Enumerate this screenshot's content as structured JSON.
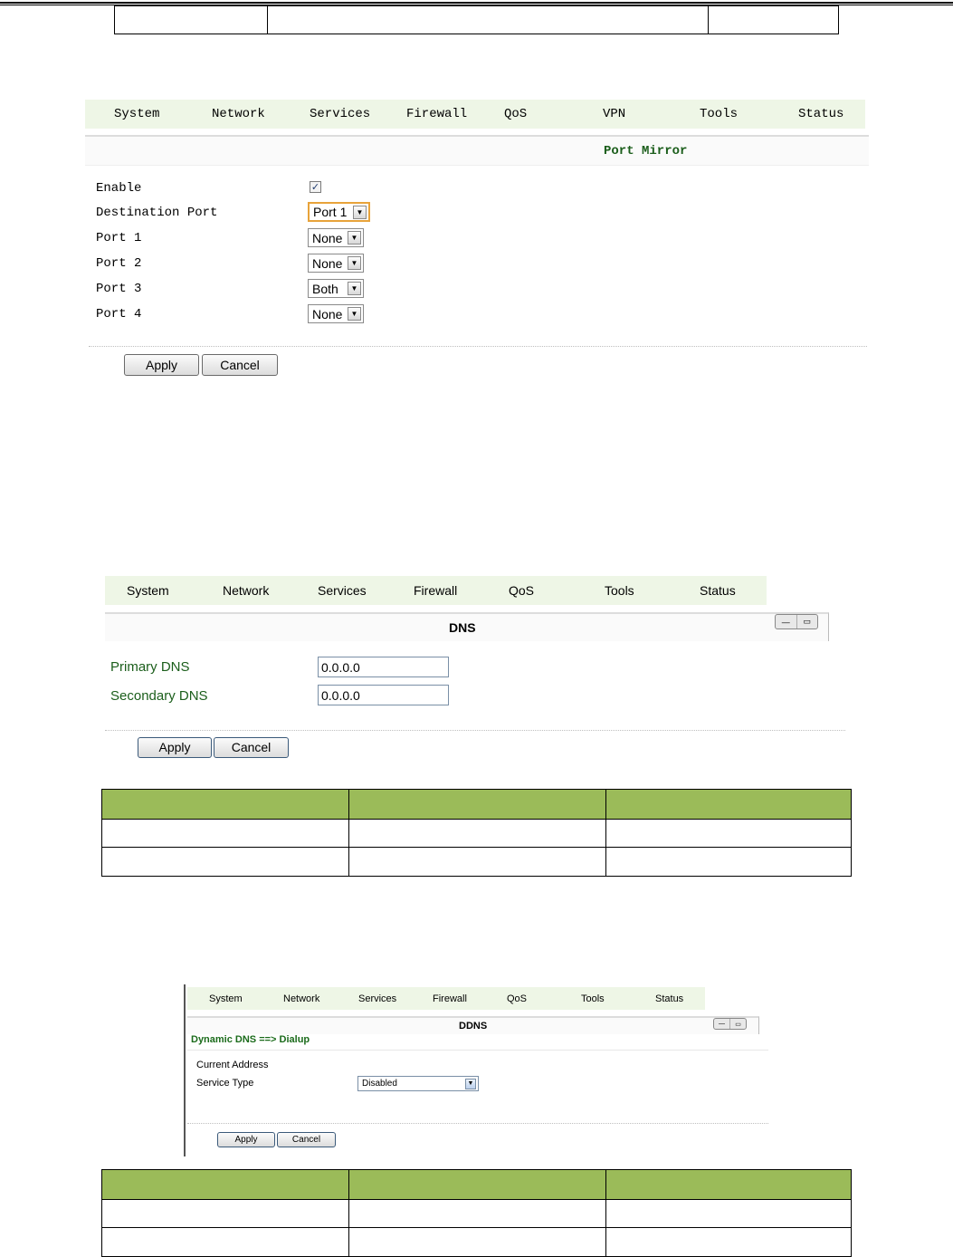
{
  "port_mirror": {
    "nav": [
      "System",
      "Network",
      "Services",
      "Firewall",
      "QoS",
      "VPN",
      "Tools",
      "Status"
    ],
    "title": "Port Mirror",
    "fields": [
      {
        "label": "Enable",
        "type": "checkbox",
        "checked": true
      },
      {
        "label": "Destination Port",
        "type": "select",
        "value": "Port 1"
      },
      {
        "label": "Port 1",
        "type": "select",
        "value": "None"
      },
      {
        "label": "Port 2",
        "type": "select",
        "value": "None"
      },
      {
        "label": "Port 3",
        "type": "select",
        "value": "Both"
      },
      {
        "label": "Port 4",
        "type": "select",
        "value": "None"
      }
    ],
    "apply_label": "Apply",
    "cancel_label": "Cancel"
  },
  "dns": {
    "nav": [
      "System",
      "Network",
      "Services",
      "Firewall",
      "QoS",
      "Tools",
      "Status"
    ],
    "title": "DNS",
    "primary_label": "Primary DNS",
    "primary_value": "0.0.0.0",
    "secondary_label": "Secondary DNS",
    "secondary_value": "0.0.0.0",
    "apply_label": "Apply",
    "cancel_label": "Cancel"
  },
  "ddns": {
    "nav": [
      "System",
      "Network",
      "Services",
      "Firewall",
      "QoS",
      "Tools",
      "Status"
    ],
    "title": "DDNS",
    "breadcrumb": "Dynamic DNS ==> Dialup",
    "current_address_label": "Current Address",
    "service_type_label": "Service Type",
    "service_type_value": "Disabled",
    "apply_label": "Apply",
    "cancel_label": "Cancel"
  },
  "colors": {
    "nav_bg": "#eef6e6",
    "title_green": "#1b5e1b",
    "table_header": "#9bbb59"
  }
}
